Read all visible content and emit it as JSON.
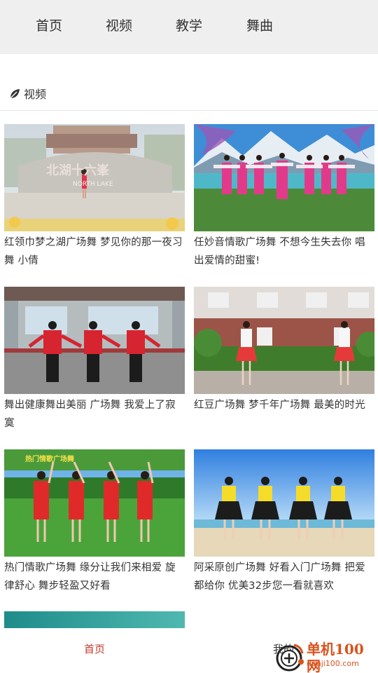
{
  "top_nav": {
    "tabs": [
      "首页",
      "视频",
      "教学",
      "舞曲"
    ]
  },
  "section": {
    "title": "视频",
    "icon": "leaf-icon"
  },
  "videos": [
    {
      "caption": "红领巾梦之湖广场舞 梦见你的那一夜习舞 小倩",
      "sign_text": "北湖十六峯",
      "sign_sub": "NORTH LAKE"
    },
    {
      "caption": "任妙音情歌广场舞 不想今生失去你 唱出爱情的甜蜜!"
    },
    {
      "caption": "舞出健康舞出美丽 广场舞 我爱上了寂寞"
    },
    {
      "caption": "红豆广场舞 梦千年广场舞 最美的时光"
    },
    {
      "caption": "热门情歌广场舞 缘分让我们来相爱 旋律舒心 舞步轻盈又好看",
      "banner_text": "热门情歌广场舞"
    },
    {
      "caption": "阿采原创广场舞 好看入门广场舞 把爱都给你 优美32步您一看就喜欢"
    },
    {
      "caption": ""
    }
  ],
  "bottom_nav": {
    "home_label": "首页",
    "mine_label": "我的",
    "active_color": "#c23a2e"
  },
  "watermark": {
    "brand": "单机100网",
    "url": "danji100.com"
  }
}
